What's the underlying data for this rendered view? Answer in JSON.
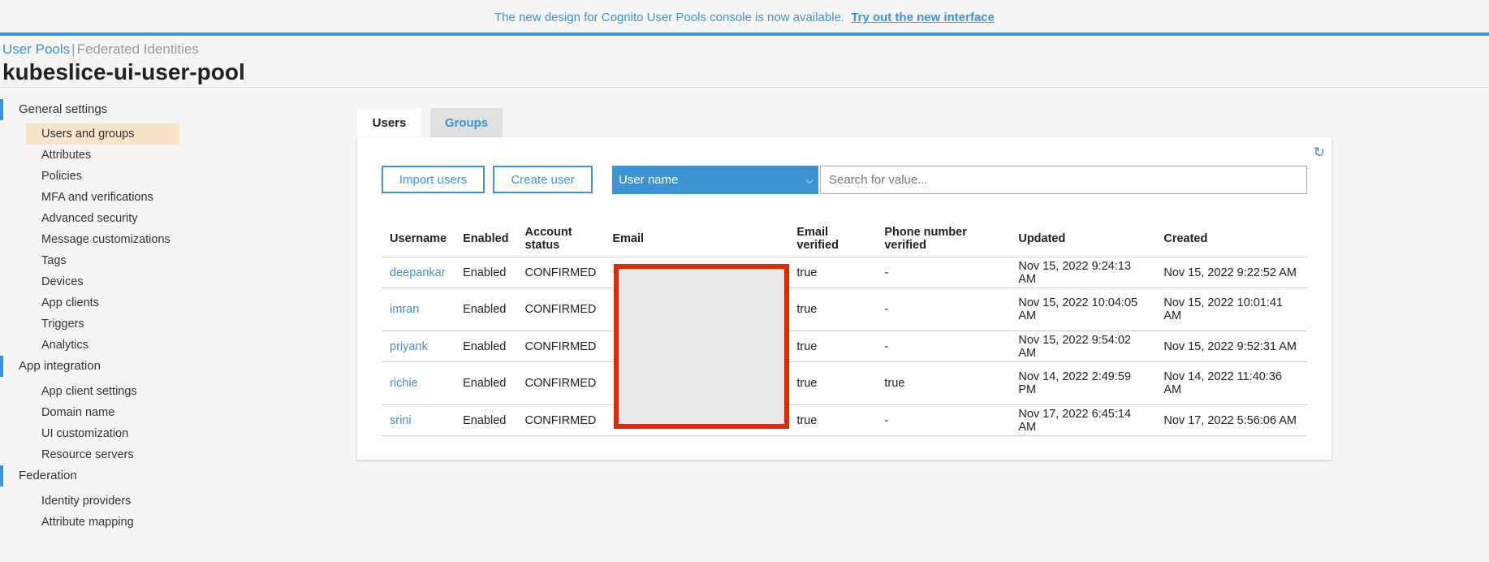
{
  "banner": {
    "text": "The new design for Cognito User Pools console is now available.",
    "link": "Try out the new interface"
  },
  "breadcrumb": {
    "user_pools": "User Pools",
    "separator": "|",
    "federated_identities": "Federated Identities"
  },
  "page_title": "kubeslice-ui-user-pool",
  "sidebar": {
    "general_settings": {
      "title": "General settings",
      "items": [
        "Users and groups",
        "Attributes",
        "Policies",
        "MFA and verifications",
        "Advanced security",
        "Message customizations",
        "Tags",
        "Devices",
        "App clients",
        "Triggers",
        "Analytics"
      ]
    },
    "app_integration": {
      "title": "App integration",
      "items": [
        "App client settings",
        "Domain name",
        "UI customization",
        "Resource servers"
      ]
    },
    "federation": {
      "title": "Federation",
      "items": [
        "Identity providers",
        "Attribute mapping"
      ]
    }
  },
  "tabs": {
    "users": "Users",
    "groups": "Groups"
  },
  "toolbar": {
    "import_users": "Import users",
    "create_user": "Create user",
    "search_field": "User name",
    "search_placeholder": "Search for value..."
  },
  "table": {
    "headers": {
      "username": "Username",
      "enabled": "Enabled",
      "account_status": "Account status",
      "email": "Email",
      "email_verified": "Email verified",
      "phone_verified": "Phone number verified",
      "updated": "Updated",
      "created": "Created"
    },
    "rows": [
      {
        "username": "deepankar",
        "enabled": "Enabled",
        "status": "CONFIRMED",
        "email": "",
        "email_verified": "true",
        "phone_verified": "-",
        "updated": "Nov 15, 2022 9:24:13 AM",
        "created": "Nov 15, 2022 9:22:52 AM"
      },
      {
        "username": "imran",
        "enabled": "Enabled",
        "status": "CONFIRMED",
        "email": "",
        "email_verified": "true",
        "phone_verified": "-",
        "updated": "Nov 15, 2022 10:04:05 AM",
        "created": "Nov 15, 2022 10:01:41 AM"
      },
      {
        "username": "priyank",
        "enabled": "Enabled",
        "status": "CONFIRMED",
        "email": "",
        "email_verified": "true",
        "phone_verified": "-",
        "updated": "Nov 15, 2022 9:54:02 AM",
        "created": "Nov 15, 2022 9:52:31 AM"
      },
      {
        "username": "richie",
        "enabled": "Enabled",
        "status": "CONFIRMED",
        "email": "",
        "email_verified": "true",
        "phone_verified": "true",
        "updated": "Nov 14, 2022 2:49:59 PM",
        "created": "Nov 14, 2022 11:40:36 AM"
      },
      {
        "username": "srini",
        "enabled": "Enabled",
        "status": "CONFIRMED",
        "email": "",
        "email_verified": "true",
        "phone_verified": "-",
        "updated": "Nov 17, 2022 6:45:14 AM",
        "created": "Nov 17, 2022 5:56:06 AM"
      }
    ]
  },
  "icons": {
    "refresh": "refresh-icon",
    "dropdown": "chevron-down-icon"
  },
  "colors": {
    "accent": "#3e93d3",
    "active_item_bg": "#f8e5c8",
    "redaction_border": "#dc2a0c"
  }
}
